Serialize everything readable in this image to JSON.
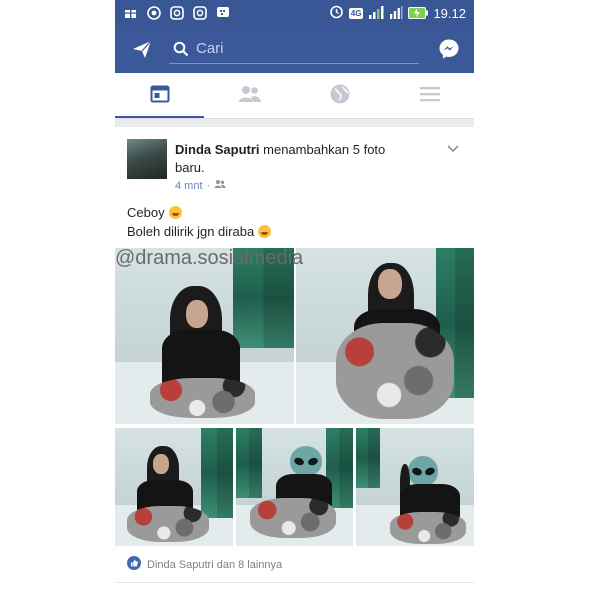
{
  "status_bar": {
    "time": "19.12",
    "network_badge": "4G",
    "left_icons": [
      "gift-icon",
      "whatsapp-icon",
      "instagram-icon",
      "instagram-icon",
      "bbm-icon"
    ],
    "right_icons": [
      "alarm-icon",
      "signal-icon",
      "battery-charging-icon"
    ]
  },
  "app_bar": {
    "search_placeholder": "Cari",
    "left_icon": "send-icon",
    "right_icon": "messenger-icon",
    "color": "#3b5998"
  },
  "tabs": [
    {
      "icon": "news-feed-icon",
      "active": true
    },
    {
      "icon": "friends-icon",
      "active": false
    },
    {
      "icon": "globe-icon",
      "active": false
    },
    {
      "icon": "menu-icon",
      "active": false
    }
  ],
  "post": {
    "author": "Dinda Saputri",
    "action": "menambahkan 5 foto baru.",
    "time": "4 mnt",
    "audience_icon": "friends-audience-icon",
    "caption_line1": "Ceboy",
    "caption_line2": "Boleh dilirik jgn diraba",
    "watermark": "@drama.sosialmedia",
    "likes_text": "Dinda Saputri dan 8 lainnya"
  },
  "colors": {
    "brand": "#3b5998",
    "link": "#6b84b4"
  }
}
